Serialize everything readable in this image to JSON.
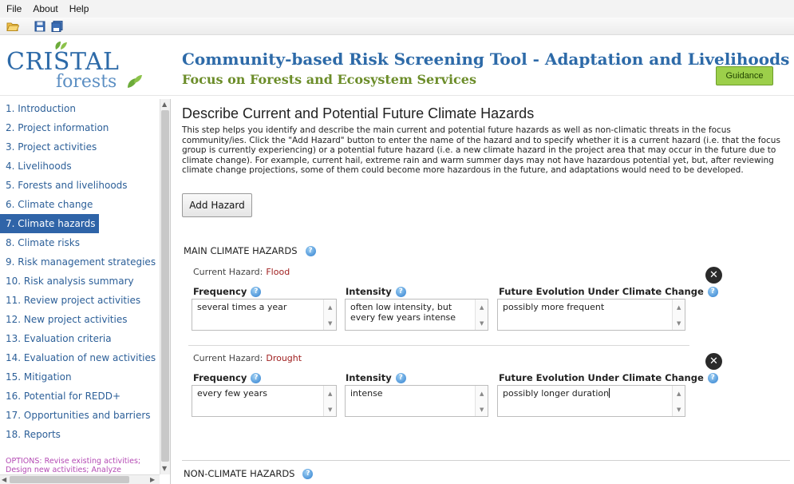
{
  "menu": {
    "file": "File",
    "about": "About",
    "help": "Help"
  },
  "logo": {
    "title": "CRISTAL",
    "subtitle": "forests"
  },
  "header": {
    "title": "Community-based Risk Screening Tool - Adaptation and Livelihoods",
    "subtitle": "Focus on Forests and Ecosystem Services",
    "guidance_label": "Guidance"
  },
  "sidebar": {
    "items": [
      "1. Introduction",
      "2. Project information",
      "3. Project activities",
      "4. Livelihoods",
      "5. Forests and livelihoods",
      "6. Climate change",
      "7. Climate hazards",
      "8. Climate risks",
      "9. Risk management strategies",
      "10. Risk analysis summary",
      "11. Review project activities",
      "12. New project activities",
      "13. Evaluation criteria",
      "14. Evaluation of new activities",
      "15. Mitigation",
      "16. Potential for REDD+",
      "17. Opportunities and barriers",
      "18. Reports"
    ],
    "active_index": 6,
    "options_text": "OPTIONS: Revise existing activities; Design new activities; Analyze"
  },
  "main": {
    "title": "Describe Current and Potential Future Climate Hazards",
    "description": "This step helps you identify and describe the main current and potential future hazards as well as non-climatic threats in the focus community/ies. Click the \"Add Hazard\" button to enter the name of the hazard and to specify whether it is a current hazard (i.e. that the focus group is currently experiencing) or a potential future hazard (i.e. a new climate hazard in the project area that may occur in the future due to climate change). For example, current hail, extreme rain and warm summer days may not have hazardous potential yet, but, after reviewing climate change projections, some of them could become more hazardous in the future, and adaptations would need to be developed.",
    "add_hazard_label": "Add Hazard",
    "main_hazards_header": "MAIN CLIMATE HAZARDS",
    "non_climate_header": "NON-CLIMATE HAZARDS",
    "current_hazard_label": "Current Hazard:",
    "col_frequency": "Frequency",
    "col_intensity": "Intensity",
    "col_future": "Future Evolution Under Climate Change",
    "hazards": [
      {
        "name": "Flood",
        "frequency": "several times a year",
        "intensity": "often low intensity, but every few years intense",
        "future": "possibly more frequent"
      },
      {
        "name": "Drought",
        "frequency": "every few years",
        "intensity": "intense",
        "future": "possibly longer duration"
      }
    ]
  },
  "icons": {
    "info": "info-icon",
    "close": "close-icon",
    "open_folder": "open-folder-icon",
    "save": "save-icon",
    "save_all": "save-all-icon"
  },
  "colors": {
    "brand_blue": "#2d6aa8",
    "brand_green": "#6c8d2a",
    "guidance_bg": "#9ccf4a",
    "active_nav": "#2f64a8",
    "hazard_value": "#a02020"
  }
}
